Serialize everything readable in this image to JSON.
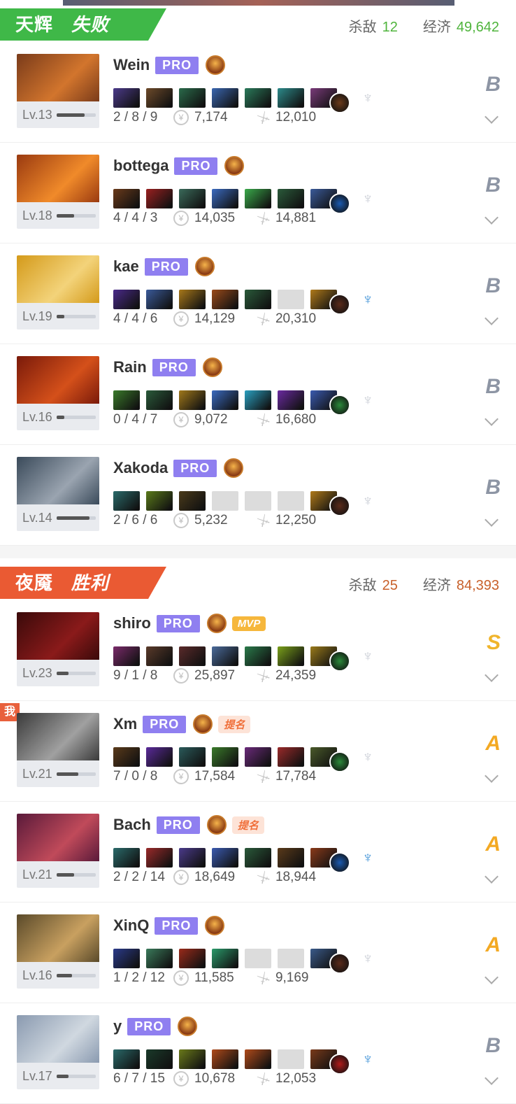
{
  "teams": [
    {
      "name": "天辉",
      "result": "失败",
      "badge_color": "#3fb848",
      "kills_label": "杀敌",
      "kills": "12",
      "gold_label": "经济",
      "gold": "49,642",
      "stat_color": "#4fb43c",
      "players": [
        {
          "name": "Wein",
          "pro": "PRO",
          "level": "Lv.13",
          "lv_fill": 0.72,
          "kda": "2 / 8 / 9",
          "gold": "7,174",
          "damage": "12,010",
          "grade": "B",
          "hero_colors": [
            "#7a3b1a",
            "#d2752d"
          ],
          "items": [
            "#4b3a8a",
            "#6d4a2a",
            "#2a6a4a",
            "#3a66b0",
            "#2a7a5a",
            "#2c8a8a",
            "#7a3a7a"
          ],
          "neutral": "#6b3a1a",
          "aghs": false
        },
        {
          "name": "bottega",
          "pro": "PRO",
          "level": "Lv.18",
          "lv_fill": 0.45,
          "kda": "4 / 4 / 3",
          "gold": "14,035",
          "damage": "14,881",
          "grade": "B",
          "hero_colors": [
            "#9a3a10",
            "#f08a2a"
          ],
          "items": [
            "#6a3a1a",
            "#9a2020",
            "#3a6a5a",
            "#3a6ac0",
            "#3aaa4a",
            "#2a5a3a",
            "#3a5a9a"
          ],
          "neutral": "#1a5ab0",
          "aghs": false
        },
        {
          "name": "kae",
          "pro": "PRO",
          "level": "Lv.19",
          "lv_fill": 0.2,
          "kda": "4 / 4 / 6",
          "gold": "14,129",
          "damage": "20,310",
          "grade": "B",
          "hero_colors": [
            "#d49a1a",
            "#f3d37a"
          ],
          "items": [
            "#4a2a8a",
            "#3a5a9a",
            "#a8781a",
            "#9a4a1a",
            "#2a5a3a",
            "empty",
            "#b07a1a"
          ],
          "neutral": "#5a2a1a",
          "aghs": true
        },
        {
          "name": "Rain",
          "pro": "PRO",
          "level": "Lv.16",
          "lv_fill": 0.2,
          "kda": "0 / 4 / 7",
          "gold": "9,072",
          "damage": "16,680",
          "grade": "B",
          "hero_colors": [
            "#7a1a0a",
            "#d4501a"
          ],
          "items": [
            "#3a7a2a",
            "#2a5a3a",
            "#a0781a",
            "#3a6ac0",
            "#2aa0c0",
            "#6a2aa0",
            "#3a5ab0"
          ],
          "neutral": "#2a8a3a",
          "aghs": false
        },
        {
          "name": "Xakoda",
          "pro": "PRO",
          "level": "Lv.14",
          "lv_fill": 0.85,
          "kda": "2 / 6 / 6",
          "gold": "5,232",
          "damage": "12,250",
          "grade": "B",
          "hero_colors": [
            "#3a4a5a",
            "#9aa4b0"
          ],
          "items": [
            "#2a6a6a",
            "#5a7a1a",
            "#4a3a1a",
            "empty",
            "empty",
            "empty",
            "#b07a1a"
          ],
          "neutral": "#5a2a1a",
          "aghs": false
        }
      ]
    },
    {
      "name": "夜魇",
      "result": "胜利",
      "badge_color": "#ea5a33",
      "kills_label": "杀敌",
      "kills": "25",
      "gold_label": "经济",
      "gold": "84,393",
      "stat_color": "#c8602a",
      "players": [
        {
          "name": "shiro",
          "pro": "PRO",
          "tag": "MVP",
          "tag_type": "mvp",
          "level": "Lv.23",
          "lv_fill": 0.3,
          "kda": "9 / 1 / 8",
          "gold": "25,897",
          "damage": "24,359",
          "grade": "S",
          "hero_colors": [
            "#3a0a0a",
            "#8a1a1a"
          ],
          "items": [
            "#7a2a6a",
            "#5a3a2a",
            "#5a2a2a",
            "#4a6a9a",
            "#2a7a4a",
            "#7aa01a",
            "#9a7a1a"
          ],
          "neutral": "#2a8a3a",
          "aghs": false
        },
        {
          "name": "Xm",
          "pro": "PRO",
          "tag": "提名",
          "tag_type": "ti",
          "me": "我",
          "level": "Lv.21",
          "lv_fill": 0.55,
          "kda": "7 / 0 / 8",
          "gold": "17,584",
          "damage": "17,784",
          "grade": "A",
          "hero_colors": [
            "#3a3a3a",
            "#a0a0a0"
          ],
          "items": [
            "#5a3a1a",
            "#5a2a9a",
            "#2a5a5a",
            "#3a7a2a",
            "#6a2a7a",
            "#9a2a2a",
            "#4a5a2a"
          ],
          "neutral": "#2a8a3a",
          "aghs": false
        },
        {
          "name": "Bach",
          "pro": "PRO",
          "tag": "提名",
          "tag_type": "ti",
          "level": "Lv.21",
          "lv_fill": 0.45,
          "kda": "2 / 2 / 14",
          "gold": "18,649",
          "damage": "18,944",
          "grade": "A",
          "hero_colors": [
            "#5a1a3a",
            "#c04a5a"
          ],
          "items": [
            "#2a6a6a",
            "#9a2a2a",
            "#4a3a8a",
            "#3a5ab0",
            "#2a5a3a",
            "#5a3a1a",
            "#8a3a1a"
          ],
          "neutral": "#1a5ab0",
          "aghs": true
        },
        {
          "name": "XinQ",
          "pro": "PRO",
          "level": "Lv.16",
          "lv_fill": 0.4,
          "kda": "1 / 2 / 12",
          "gold": "11,585",
          "damage": "9,169",
          "grade": "A",
          "hero_colors": [
            "#5a4a2a",
            "#c8a060"
          ],
          "items": [
            "#2a3a8a",
            "#3a7a5a",
            "#9a2a1a",
            "#2a9a6a",
            "empty",
            "empty",
            "#3a5a8a"
          ],
          "neutral": "#5a2a1a",
          "aghs": false
        },
        {
          "name": "y",
          "pro": "PRO",
          "level": "Lv.17",
          "lv_fill": 0.3,
          "kda": "6 / 7 / 15",
          "gold": "10,678",
          "damage": "12,053",
          "grade": "B",
          "hero_colors": [
            "#8a9ab0",
            "#d0d8e0"
          ],
          "items": [
            "#2a6a6a",
            "#1a3a2a",
            "#6a7a1a",
            "#b04a1a",
            "#b04a1a",
            "empty",
            "#7a3a1a"
          ],
          "neutral": "#b01a1a",
          "aghs": true
        }
      ]
    }
  ]
}
